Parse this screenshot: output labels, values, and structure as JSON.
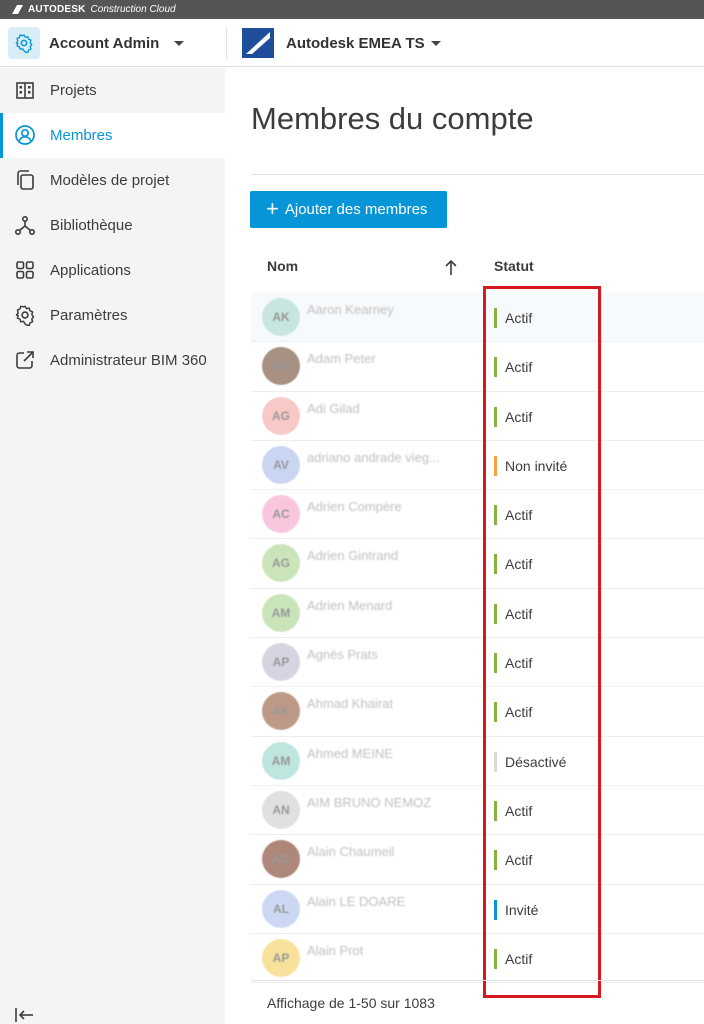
{
  "topbar": {
    "brand": "AUTODESK",
    "brand_sub": "Construction Cloud"
  },
  "header": {
    "account_label": "Account Admin",
    "project_label": "Autodesk EMEA TS"
  },
  "sidebar": {
    "items": [
      {
        "label": "Projets",
        "icon": "building-icon"
      },
      {
        "label": "Membres",
        "icon": "user-circle-icon",
        "active": true
      },
      {
        "label": "Modèles de projet",
        "icon": "copy-icon"
      },
      {
        "label": "Bibliothèque",
        "icon": "library-icon"
      },
      {
        "label": "Applications",
        "icon": "apps-grid-icon"
      },
      {
        "label": "Paramètres",
        "icon": "gear-icon"
      },
      {
        "label": "Administrateur BIM 360",
        "icon": "external-link-icon"
      }
    ]
  },
  "main": {
    "title": "Membres du compte",
    "add_button": "Ajouter des membres",
    "columns": {
      "name": "Nom",
      "status": "Statut"
    },
    "pager": "Affichage de 1-50 sur 1083"
  },
  "members": [
    {
      "initials": "AK",
      "name": "Aaron Kearney",
      "status": "Actif"
    },
    {
      "initials": "AP",
      "name": "Adam Peter",
      "status": "Actif"
    },
    {
      "initials": "AG",
      "name": "Adi Gilad",
      "status": "Actif"
    },
    {
      "initials": "AV",
      "name": "adriano andrade vieg...",
      "status": "Non invité"
    },
    {
      "initials": "AC",
      "name": "Adrien Compère",
      "status": "Actif"
    },
    {
      "initials": "AG",
      "name": "Adrien Gintrand",
      "status": "Actif"
    },
    {
      "initials": "AM",
      "name": "Adrien Menard",
      "status": "Actif"
    },
    {
      "initials": "AP",
      "name": "Agnès Prats",
      "status": "Actif"
    },
    {
      "initials": "AK",
      "name": "Ahmad Khairat",
      "status": "Actif"
    },
    {
      "initials": "AM",
      "name": "Ahmed MEINE",
      "status": "Désactivé"
    },
    {
      "initials": "AN",
      "name": "AIM BRUNO NEMOZ",
      "status": "Actif"
    },
    {
      "initials": "AC",
      "name": "Alain Chaumeil",
      "status": "Actif"
    },
    {
      "initials": "AL",
      "name": "Alain LE DOARE",
      "status": "Invité"
    },
    {
      "initials": "AP",
      "name": "Alain Prot",
      "status": "Actif"
    }
  ],
  "status_colors": {
    "Actif": "#87b340",
    "Non invité": "#f2a43a",
    "Désactivé": "#d9d9d9",
    "Invité": "#0696d7"
  },
  "avatar_colors": [
    "#b8e0d6",
    "#8b6b5a",
    "#f6b7b4",
    "#b9c8ee",
    "#f8b4d4",
    "#bcdca3",
    "#b9dca4",
    "#c8c8d8",
    "#a8785f",
    "#a9ddd3",
    "#d6d6d6",
    "#94604f",
    "#bccbef",
    "#f5d77a"
  ],
  "accent_color": "#0696d7"
}
